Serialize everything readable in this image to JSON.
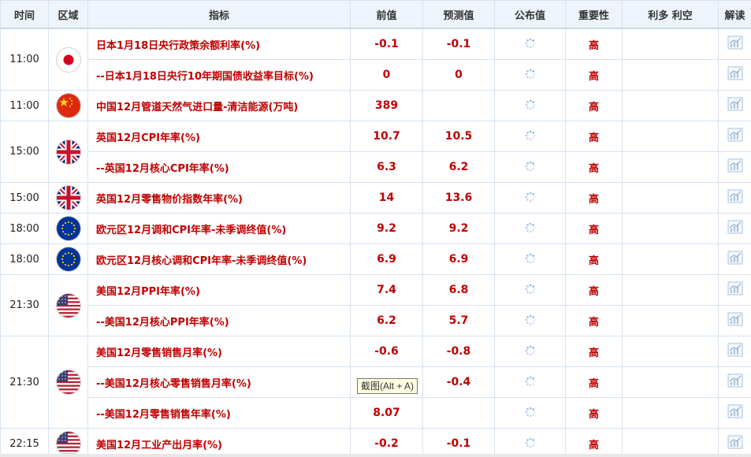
{
  "headers": {
    "time": "时间",
    "region": "区域",
    "indicator": "指标",
    "previous": "前值",
    "forecast": "预测值",
    "published": "公布值",
    "importance": "重要性",
    "bull_bear": "利多 利空",
    "interpret": "解读"
  },
  "rows": [
    {
      "time": "11:00",
      "flag": "jp-flag-icon",
      "indicator": "日本1月18日央行政策余额利率(%)",
      "previous": "-0.1",
      "forecast": "-0.1",
      "importance": "高"
    },
    {
      "indicator": "--日本1月18日央行10年期国债收益率目标(%)",
      "previous": "0",
      "forecast": "0",
      "importance": "高"
    },
    {
      "time": "11:00",
      "flag": "cn-flag-icon",
      "indicator": "中国12月管道天然气进口量-清洁能源(万吨)",
      "previous": "389",
      "forecast": "",
      "importance": "高"
    },
    {
      "time": "15:00",
      "flag": "uk-flag-icon",
      "indicator": "英国12月CPI年率(%)",
      "previous": "10.7",
      "forecast": "10.5",
      "importance": "高"
    },
    {
      "indicator": "--英国12月核心CPI年率(%)",
      "previous": "6.3",
      "forecast": "6.2",
      "importance": "高"
    },
    {
      "time": "15:00",
      "flag": "uk-flag-icon",
      "indicator": "英国12月零售物价指数年率(%)",
      "previous": "14",
      "forecast": "13.6",
      "importance": "高"
    },
    {
      "time": "18:00",
      "flag": "eu-flag-icon",
      "indicator": "欧元区12月调和CPI年率-未季调终值(%)",
      "previous": "9.2",
      "forecast": "9.2",
      "importance": "高"
    },
    {
      "time": "18:00",
      "flag": "eu-flag-icon",
      "indicator": "欧元区12月核心调和CPI年率-未季调终值(%)",
      "previous": "6.9",
      "forecast": "6.9",
      "importance": "高"
    },
    {
      "time": "21:30",
      "flag": "us-flag-icon",
      "indicator": "美国12月PPI年率(%)",
      "previous": "7.4",
      "forecast": "6.8",
      "importance": "高"
    },
    {
      "indicator": "--美国12月核心PPI年率(%)",
      "previous": "6.2",
      "forecast": "5.7",
      "importance": "高"
    },
    {
      "time": "21:30",
      "flag": "us-flag-icon",
      "indicator": "美国12月零售销售月率(%)",
      "previous": "-0.6",
      "forecast": "-0.8",
      "importance": "高"
    },
    {
      "indicator": "--美国12月核心零售销售月率(%)",
      "previous": "",
      "forecast": "-0.4",
      "importance": "高"
    },
    {
      "indicator": "--美国12月零售销售年率(%)",
      "previous": "8.07",
      "forecast": "",
      "importance": "高"
    },
    {
      "time": "22:15",
      "flag": "us-flag-icon",
      "indicator": "美国12月工业产出月率(%)",
      "previous": "-0.2",
      "forecast": "-0.1",
      "importance": "高"
    }
  ],
  "tooltip": "截图(Alt + A)",
  "colors": {
    "header_bg": "#eef4fb",
    "border": "#d6e3f0",
    "value_red": "#c00000"
  }
}
